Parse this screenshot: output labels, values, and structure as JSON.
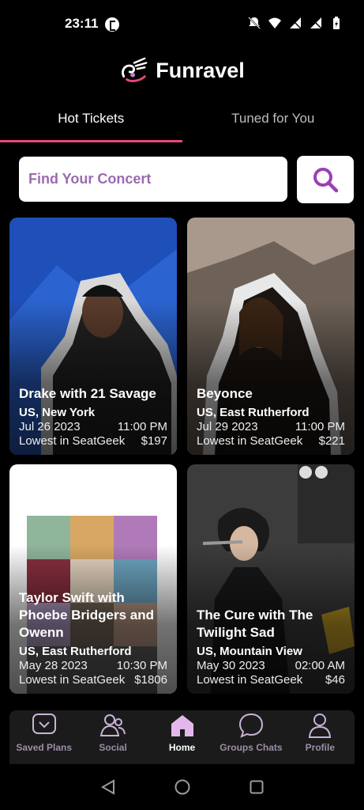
{
  "status": {
    "time": "23:11"
  },
  "app": {
    "name": "Funravel"
  },
  "tabs": [
    {
      "label": "Hot Tickets"
    },
    {
      "label": "Tuned for You"
    }
  ],
  "search": {
    "placeholder": "Find Your Concert"
  },
  "concerts": [
    {
      "title": "Drake with 21 Savage",
      "location": "US, New York",
      "date": "Jul 26 2023",
      "time": "11:00 PM",
      "source": "Lowest in SeatGeek",
      "price": "$197"
    },
    {
      "title": "Beyonce",
      "location": "US, East Rutherford",
      "date": "Jul 29 2023",
      "time": "11:00 PM",
      "source": "Lowest in SeatGeek",
      "price": "$221"
    },
    {
      "title": "Taylor Swift with Phoebe Bridgers and Owenn",
      "location": "US, East Rutherford",
      "date": "May 28 2023",
      "time": "10:30 PM",
      "source": "Lowest in SeatGeek",
      "price": "$1806"
    },
    {
      "title": "The Cure with The Twilight Sad",
      "location": "US, Mountain View",
      "date": "May 30 2023",
      "time": "02:00 AM",
      "source": "Lowest in SeatGeek",
      "price": "$46"
    }
  ],
  "nav": [
    {
      "label": "Saved Plans",
      "icon": "bookmark-icon"
    },
    {
      "label": "Social",
      "icon": "people-icon"
    },
    {
      "label": "Home",
      "icon": "home-icon"
    },
    {
      "label": "Groups Chats",
      "icon": "chat-bubble-icon"
    },
    {
      "label": "Profile",
      "icon": "person-icon"
    }
  ],
  "colors": {
    "accent": "#e8477f",
    "purple": "#9b3fb5",
    "placeholder": "#9b6bb0",
    "home_active": "#e2b8ec"
  }
}
